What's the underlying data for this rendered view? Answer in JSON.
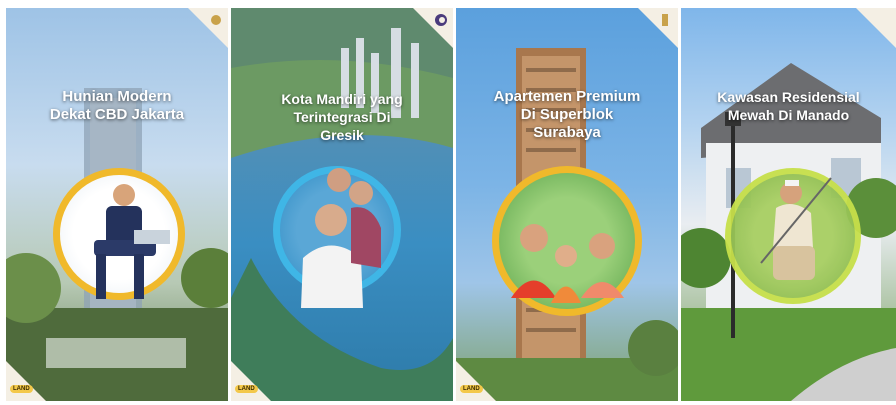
{
  "panels": [
    {
      "headline_line1": "Hunian Modern",
      "headline_line2": "Dekat CBD Jakarta",
      "brand": "LAND",
      "ring_color": "#f0b92b",
      "theme": "business-man-with-laptop"
    },
    {
      "headline_line1": "Kota Mandiri yang",
      "headline_line2": "Terintegrasi Di",
      "headline_line3": "Gresik",
      "brand": "LAND",
      "ring_color": "#3fb6e6",
      "theme": "couple-waterfront-city"
    },
    {
      "headline_line1": "Apartemen Premium",
      "headline_line2": "Di Superblok",
      "headline_line3": "Surabaya",
      "brand": "LAND",
      "ring_color": "#f0b92b",
      "theme": "family-apartment-tower"
    },
    {
      "headline_line1": "Kawasan Residensial",
      "headline_line2": "Mewah Di Manado",
      "brand": "",
      "ring_color": "#c7e04a",
      "theme": "golfer-house"
    }
  ]
}
